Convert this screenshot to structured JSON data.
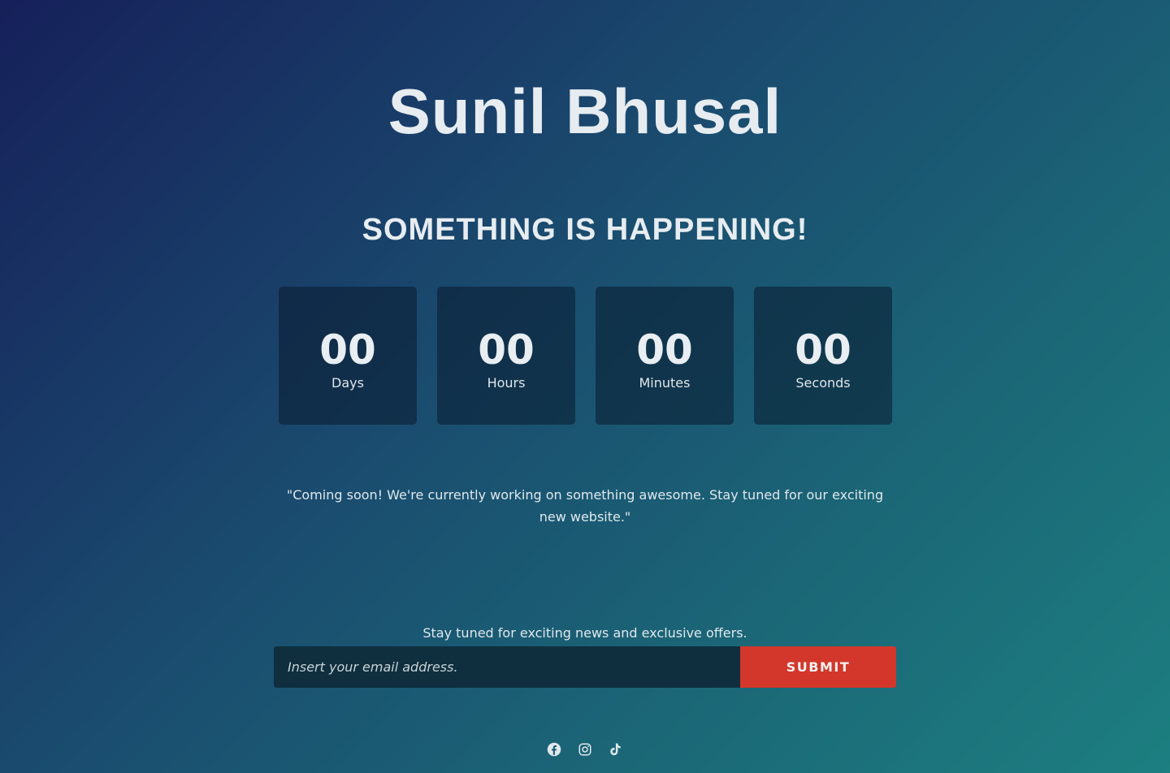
{
  "header": {
    "title": "Sunil Bhusal",
    "subtitle": "SOMETHING IS HAPPENING!"
  },
  "countdown": [
    {
      "value": "00",
      "label": "Days"
    },
    {
      "value": "00",
      "label": "Hours"
    },
    {
      "value": "00",
      "label": "Minutes"
    },
    {
      "value": "00",
      "label": "Seconds"
    }
  ],
  "message": "\"Coming soon! We're currently working on something awesome. Stay tuned for our exciting new website.\"",
  "newsletter": {
    "text": "Stay tuned for exciting news and exclusive offers.",
    "email_placeholder": "Insert your email address.",
    "email_value": "",
    "submit_label": "SUBMIT"
  },
  "social": [
    {
      "icon": "facebook-icon"
    },
    {
      "icon": "instagram-icon"
    },
    {
      "icon": "tiktok-icon"
    }
  ],
  "colors": {
    "background_start": "#16205a",
    "background_end": "#1c7f80",
    "submit_button": "#d3372b",
    "input_background": "#0f2f3e"
  }
}
